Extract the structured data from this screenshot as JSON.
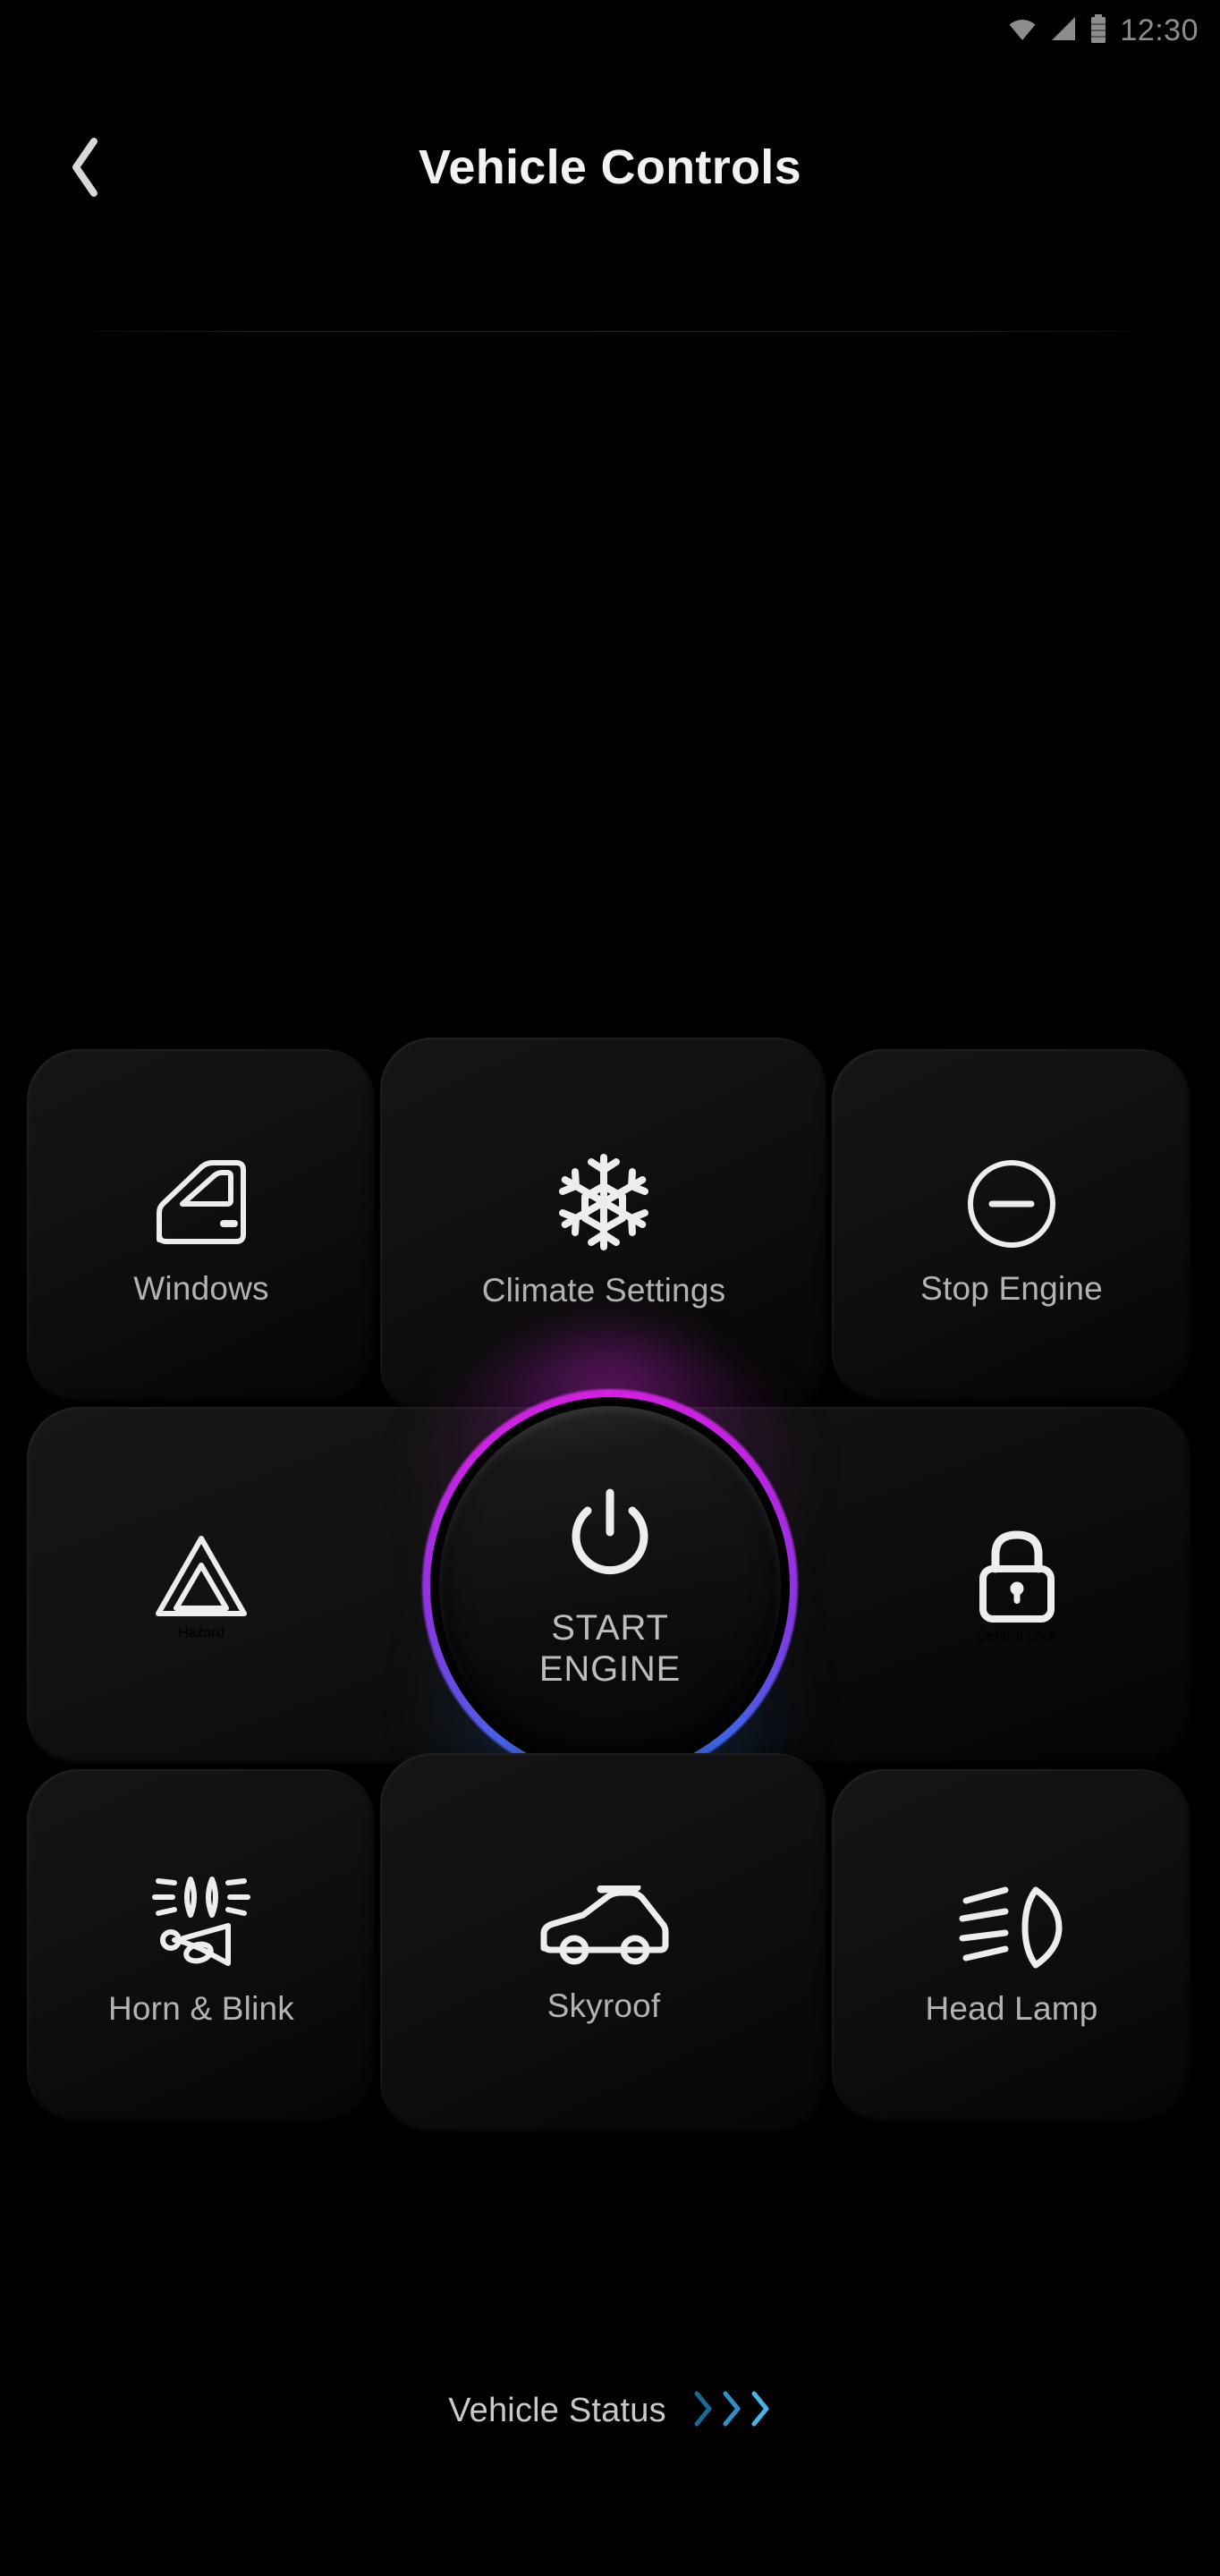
{
  "status_bar": {
    "wifi_icon": "wifi-icon",
    "signal_icon": "signal-icon",
    "battery_icon": "battery-icon",
    "time": "12:30"
  },
  "header": {
    "back_icon": "chevron-left-icon",
    "title": "Vehicle Controls"
  },
  "controls": {
    "tiles": [
      {
        "id": "windows",
        "label": "Windows",
        "icon": "car-door-icon"
      },
      {
        "id": "climate",
        "label": "Climate Settings",
        "icon": "snowflake-icon"
      },
      {
        "id": "stop-engine",
        "label": "Stop Engine",
        "icon": "minus-circle-icon"
      },
      {
        "id": "hazard",
        "label": "Hazard",
        "icon": "hazard-triangle-icon"
      },
      {
        "id": "central-lock",
        "label": "Central Lock",
        "icon": "lock-closed-icon"
      },
      {
        "id": "horn",
        "label": "Horn & Blink",
        "icon": "horn-blink-icon"
      },
      {
        "id": "skyroof",
        "label": "Skyroof",
        "icon": "car-sunroof-icon"
      },
      {
        "id": "headlamp",
        "label": "Head Lamp",
        "icon": "headlamp-icon"
      }
    ],
    "start_engine": {
      "label_line1": "START",
      "label_line2": "ENGINE",
      "icon": "power-icon",
      "ring_color_top": "#d41fe0",
      "ring_color_bottom": "#2f86ec"
    }
  },
  "footer": {
    "label": "Vehicle Status",
    "chevron_icon": "chevron-right-icon",
    "chevron_count": 3,
    "chevron_color": "#3aa8e0"
  },
  "colors": {
    "background": "#000000",
    "tile_surface": "#101010",
    "label_text": "#b3b3b3",
    "title_text": "#f2f2f2",
    "status_text": "#8d8d8d",
    "icon_stroke": "#ededed"
  }
}
